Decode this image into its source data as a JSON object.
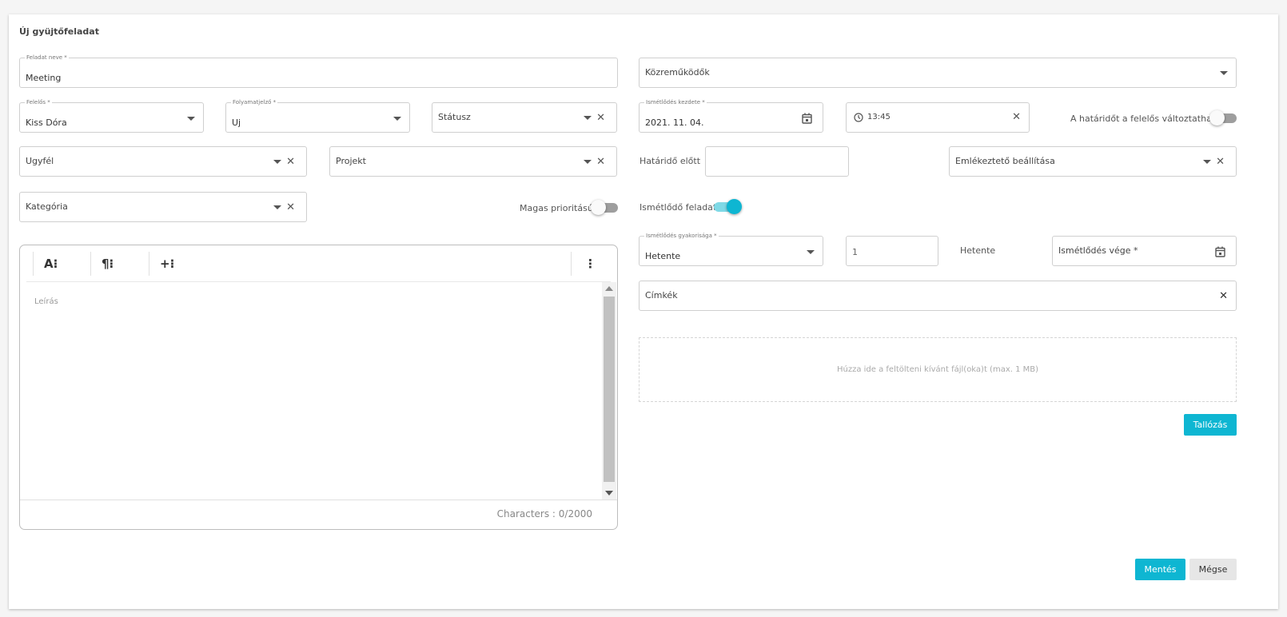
{
  "form": {
    "title": "Új gyüjtőfeladat",
    "task_name": {
      "label": "Feladat neve *",
      "value": "Meeting"
    },
    "contributors": {
      "placeholder": "Közreműködők"
    },
    "responsible": {
      "label": "Felelős *",
      "value": "Kiss Dóra"
    },
    "progress": {
      "label": "Folyamatjelző *",
      "value": "Uj"
    },
    "status": {
      "placeholder": "Státusz"
    },
    "repeat_start": {
      "label": "Ismétlődés kezdete *",
      "value": "2021. 11. 04."
    },
    "time": {
      "value": "13:45"
    },
    "deadline_changeable": {
      "label": "A határidőt a felelős változtathatja",
      "on": false
    },
    "client": {
      "placeholder": "Ugyfél"
    },
    "project": {
      "placeholder": "Projekt"
    },
    "before_deadline": {
      "label": "Határidő előtt",
      "value": ""
    },
    "reminder": {
      "placeholder": "Emlékeztető beállítása"
    },
    "category": {
      "placeholder": "Kategória"
    },
    "high_priority": {
      "label": "Magas prioritású",
      "on": false
    },
    "recurring": {
      "label": "Ismétlődő feladat",
      "on": true
    },
    "frequency": {
      "label": "Ismétlődés gyakorisága *",
      "value": "Hetente"
    },
    "interval": {
      "value": "1"
    },
    "interval_unit": "Hetente",
    "repeat_end": {
      "placeholder": "Ismétlődés vége *"
    },
    "tags": {
      "placeholder": "Címkék"
    },
    "upload": {
      "text": "Húzza ide a feltölteni kívánt fájl(oka)t (max. 1 MB)",
      "browse_label": "Tallózás"
    },
    "editor": {
      "toolbar": {
        "font": "A⁝",
        "paragraph": "¶⁝",
        "insert": "+⁝",
        "more": "⋮"
      },
      "placeholder": "Leírás",
      "char_count": "Characters : 0/2000"
    },
    "actions": {
      "save": "Mentés",
      "cancel": "Mégse"
    }
  },
  "colors": {
    "accent": "#0eb6d2",
    "border": "#cfcfcf"
  }
}
